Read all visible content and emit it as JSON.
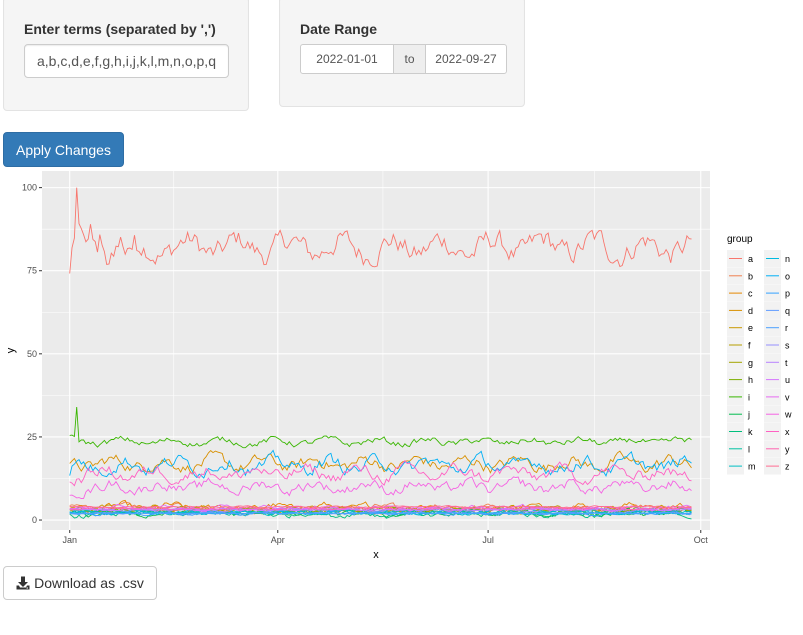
{
  "terms_panel": {
    "label": "Enter terms (separated by ',')",
    "input_value": "a,b,c,d,e,f,g,h,i,j,k,l,m,n,o,p,q"
  },
  "date_panel": {
    "label": "Date Range",
    "start": "2022-01-01",
    "separator": "to",
    "end": "2022-09-27"
  },
  "apply_button": {
    "label": "Apply Changes",
    "color": "#337ab7"
  },
  "download_button": {
    "label": "Download as .csv",
    "icon": "download-icon"
  },
  "chart_data": {
    "type": "line",
    "title": "",
    "xlabel": "x",
    "ylabel": "y",
    "x_range": [
      "2021-12-20",
      "2022-10-05"
    ],
    "x_start": "2022-01-01",
    "x_end": "2022-09-27",
    "ylim": [
      -3,
      105
    ],
    "y_ticks": [
      0,
      25,
      50,
      75,
      100
    ],
    "y_tick_labels": [
      "0",
      "25",
      "50",
      "75",
      "100"
    ],
    "x_ticks": [
      "2022-01-01",
      "2022-04-01",
      "2022-07-01",
      "2022-10-01"
    ],
    "x_tick_labels": [
      "Jan",
      "Apr",
      "Jul",
      "Oct"
    ],
    "grid": true,
    "legend": {
      "title": "group",
      "position": "right",
      "columns": 2
    },
    "series": [
      {
        "name": "a",
        "color": "#F8766D",
        "level": 82,
        "noise": 3.5,
        "start": 71,
        "peak": 100
      },
      {
        "name": "b",
        "color": "#F07F4F",
        "level": 3.5,
        "noise": 0.9
      },
      {
        "name": "c",
        "color": "#E58700",
        "level": 3.8,
        "noise": 1.0
      },
      {
        "name": "d",
        "color": "#D89000",
        "level": 17,
        "noise": 1.8,
        "start": 15
      },
      {
        "name": "e",
        "color": "#C99800",
        "level": 3.2,
        "noise": 0.8
      },
      {
        "name": "f",
        "color": "#B79F00",
        "level": 3.0,
        "noise": 0.7
      },
      {
        "name": "g",
        "color": "#A3A500",
        "level": 3.1,
        "noise": 0.6
      },
      {
        "name": "h",
        "color": "#7CAE00",
        "level": 3.0,
        "noise": 0.6
      },
      {
        "name": "i",
        "color": "#39B600",
        "level": 23.5,
        "noise": 1.0,
        "start": 25,
        "peak": 34
      },
      {
        "name": "j",
        "color": "#00BB4E",
        "level": 2.0,
        "noise": 0.8
      },
      {
        "name": "k",
        "color": "#00BF7D",
        "level": 1.8,
        "noise": 0.8
      },
      {
        "name": "l",
        "color": "#00C1A3",
        "level": 2.4,
        "noise": 0.5
      },
      {
        "name": "m",
        "color": "#00BFC4",
        "level": 2.3,
        "noise": 0.5
      },
      {
        "name": "n",
        "color": "#00BAE0",
        "level": 2.2,
        "noise": 0.5
      },
      {
        "name": "o",
        "color": "#00B0F6",
        "level": 16.5,
        "noise": 2.0,
        "start": 13
      },
      {
        "name": "p",
        "color": "#35A2FF",
        "level": 2.0,
        "noise": 0.4
      },
      {
        "name": "q",
        "color": "#619CFF",
        "level": 2.1,
        "noise": 0.2
      },
      {
        "name": "r",
        "color": "#4AA0FF",
        "level": 2.0,
        "noise": 0.1
      },
      {
        "name": "s",
        "color": "#9590FF",
        "level": 3.0,
        "noise": 0.3
      },
      {
        "name": "t",
        "color": "#B983FF",
        "level": 3.2,
        "noise": 0.3
      },
      {
        "name": "u",
        "color": "#D575FE",
        "level": 3.3,
        "noise": 0.4
      },
      {
        "name": "v",
        "color": "#E76BF3",
        "level": 3.5,
        "noise": 0.6
      },
      {
        "name": "w",
        "color": "#F564E3",
        "level": 10,
        "noise": 1.6,
        "start": 8
      },
      {
        "name": "x",
        "color": "#FF61C3",
        "level": 14,
        "noise": 1.8,
        "start": 10
      },
      {
        "name": "y",
        "color": "#FF64B0",
        "level": 3.6,
        "noise": 0.3
      },
      {
        "name": "z",
        "color": "#FF6C91",
        "level": 4.0,
        "noise": 0.2
      }
    ]
  }
}
